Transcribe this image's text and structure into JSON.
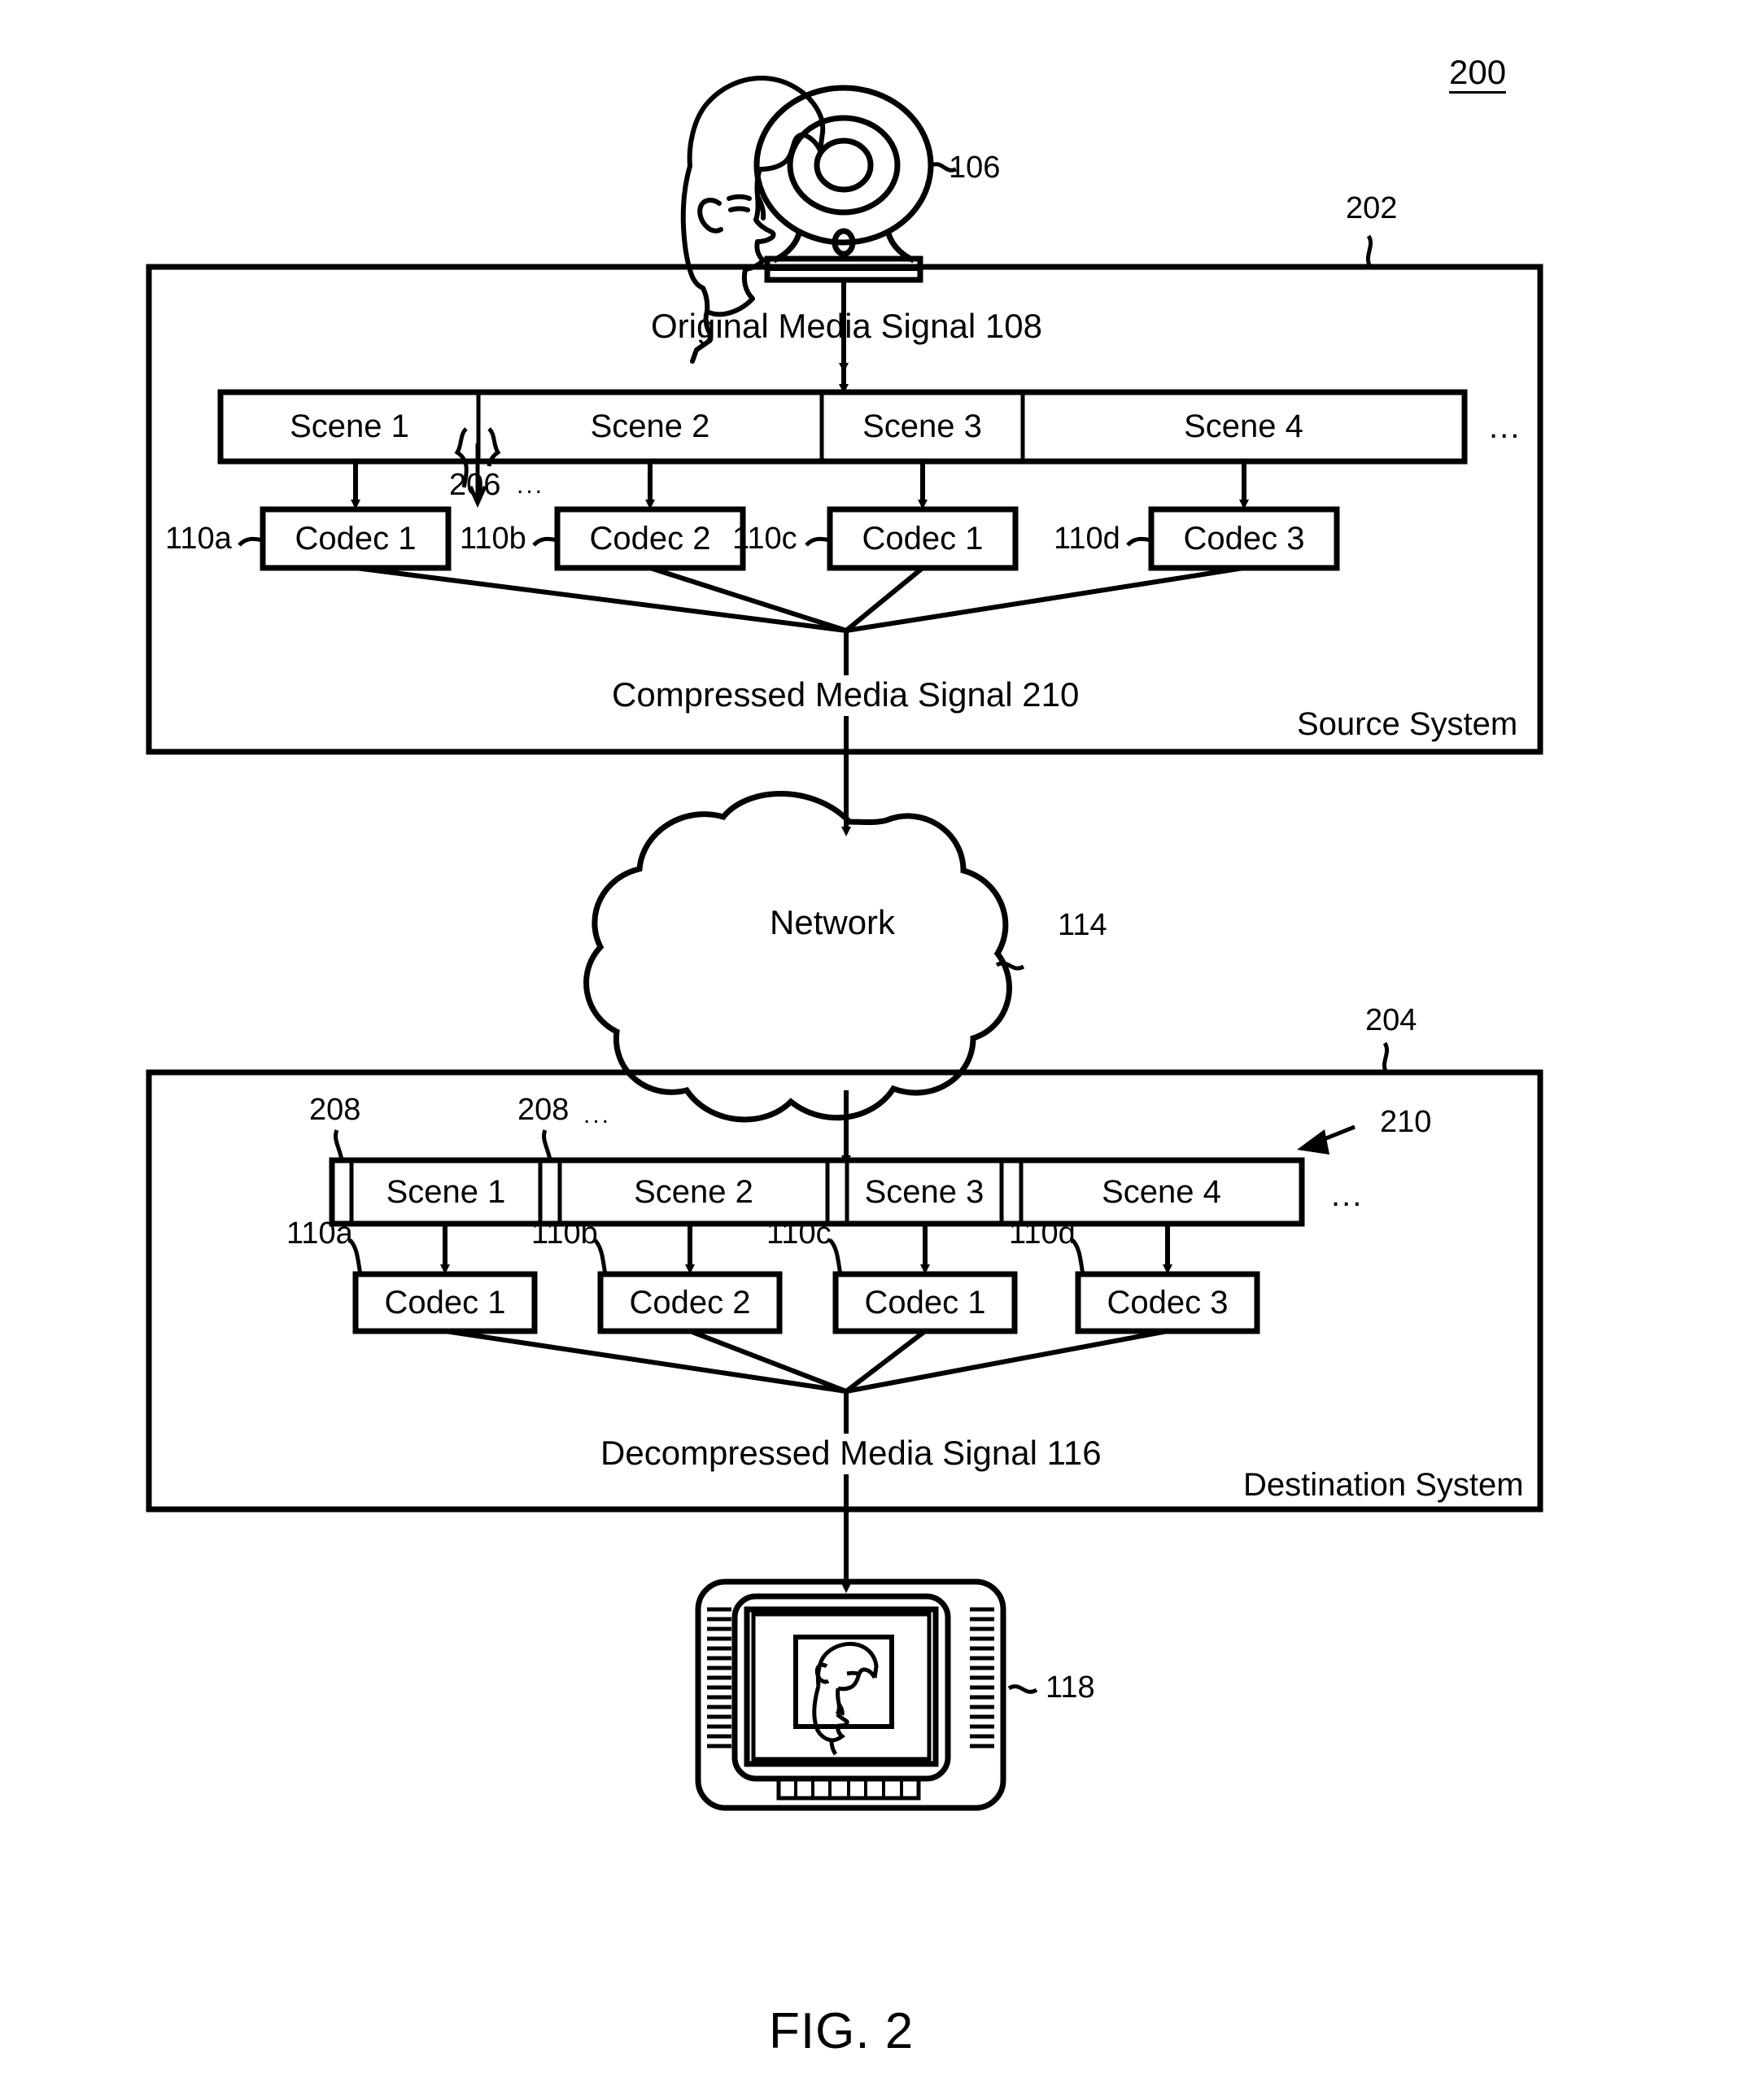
{
  "figure": {
    "caption": "FIG. 2",
    "system_ref": "200"
  },
  "source_system": {
    "ref": "202",
    "label": "Source System",
    "input_signal_label": "Original Media Signal 108",
    "output_signal_label": "Compressed Media Signal 210",
    "scene_boundary_ref": "206",
    "scene_boundary_ellipsis": "...",
    "track_ellipsis": "...",
    "scenes": [
      {
        "label": "Scene 1"
      },
      {
        "label": "Scene 2"
      },
      {
        "label": "Scene 3"
      },
      {
        "label": "Scene 4"
      }
    ],
    "codecs": [
      {
        "ref": "110a",
        "label": "Codec 1"
      },
      {
        "ref": "110b",
        "label": "Codec 2"
      },
      {
        "ref": "110c",
        "label": "Codec 1"
      },
      {
        "ref": "110d",
        "label": "Codec 3"
      }
    ]
  },
  "camera": {
    "ref": "106"
  },
  "network": {
    "label": "Network",
    "ref": "114"
  },
  "destination_system": {
    "ref": "204",
    "label": "Destination System",
    "stream_ref": "210",
    "output_signal_label": "Decompressed Media Signal 116",
    "marker_ref_1": "208",
    "marker_ref_2": "208",
    "marker_ellipsis": "...",
    "track_ellipsis": "...",
    "scenes": [
      {
        "label": "Scene 1"
      },
      {
        "label": "Scene 2"
      },
      {
        "label": "Scene 3"
      },
      {
        "label": "Scene 4"
      }
    ],
    "codecs": [
      {
        "ref": "110a",
        "label": "Codec 1"
      },
      {
        "ref": "110b",
        "label": "Codec 2"
      },
      {
        "ref": "110c",
        "label": "Codec 1"
      },
      {
        "ref": "110d",
        "label": "Codec 3"
      }
    ]
  },
  "display": {
    "ref": "118"
  },
  "colors": {
    "ink": "#000000",
    "paper": "#ffffff"
  }
}
